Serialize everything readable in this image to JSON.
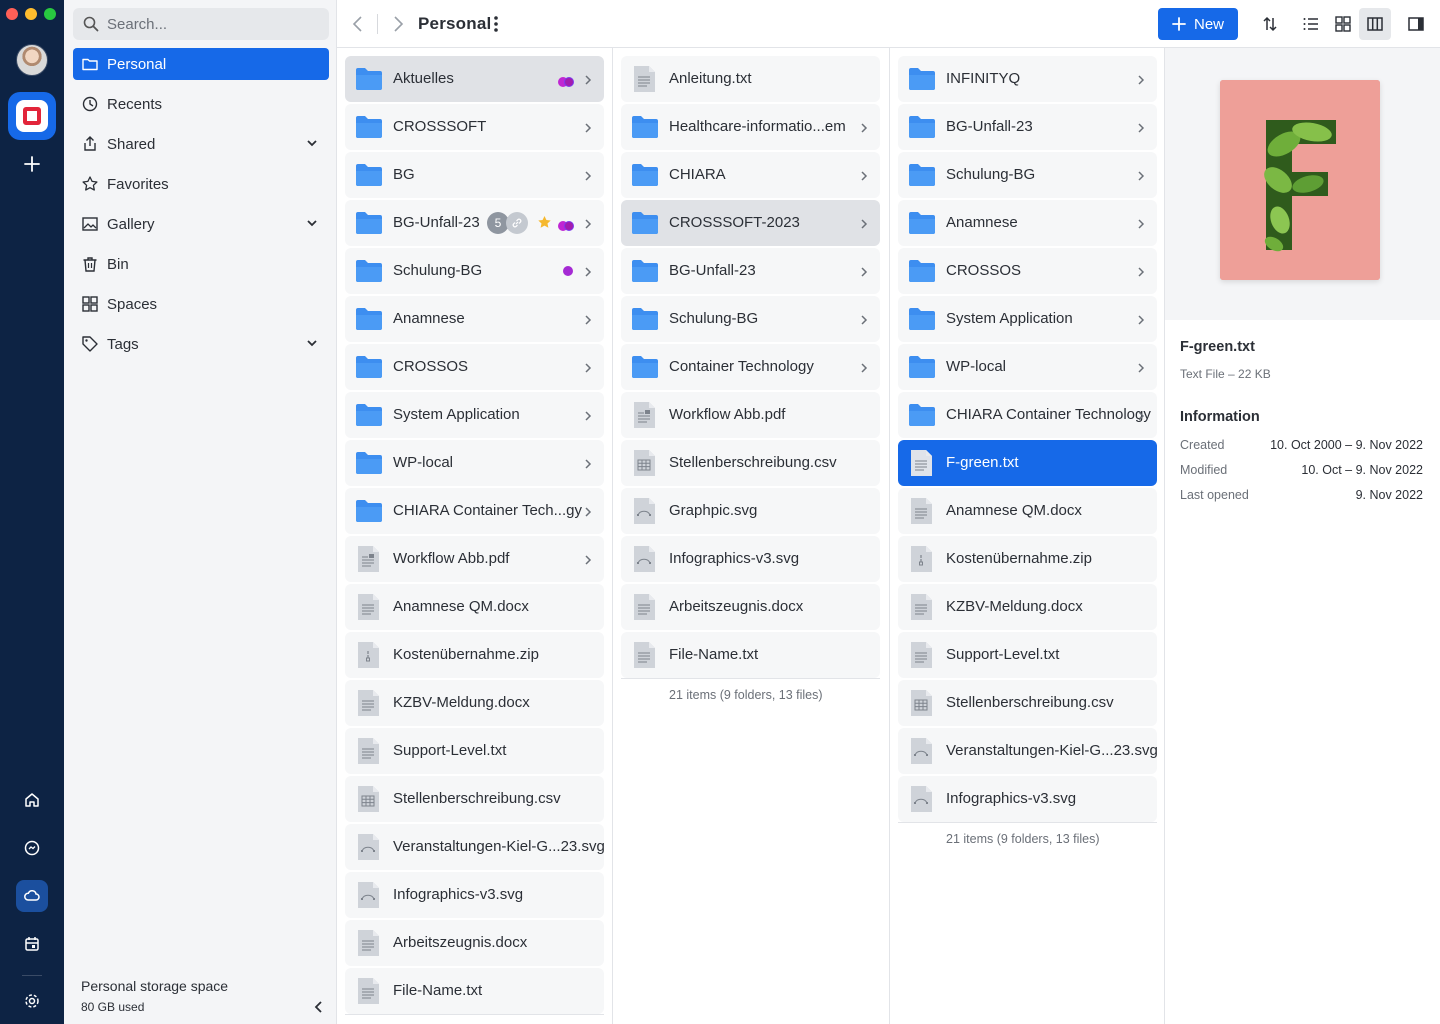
{
  "colors": {
    "accent": "#1669e8",
    "rail": "#0d2344",
    "folder": "#3d8ef0",
    "purple": "#a52ad4",
    "star": "#f5b82e"
  },
  "window_controls": [
    "close",
    "minimize",
    "maximize"
  ],
  "search": {
    "placeholder": "Search..."
  },
  "sidebar": {
    "items": [
      {
        "label": "Personal",
        "icon": "folder-icon",
        "active": true
      },
      {
        "label": "Recents",
        "icon": "clock-icon"
      },
      {
        "label": "Shared",
        "icon": "share-icon",
        "expandable": true
      },
      {
        "label": "Favorites",
        "icon": "star-icon"
      },
      {
        "label": "Gallery",
        "icon": "gallery-icon",
        "expandable": true
      },
      {
        "label": "Bin",
        "icon": "trash-icon"
      },
      {
        "label": "Spaces",
        "icon": "grid-icon"
      },
      {
        "label": "Tags",
        "icon": "tag-icon",
        "expandable": true
      }
    ],
    "storage_title": "Personal storage space",
    "storage_used": "80 GB used"
  },
  "toolbar": {
    "title": "Personal",
    "new_label": "New"
  },
  "columns": [
    {
      "items": [
        {
          "name": "Aktuelles",
          "type": "folder",
          "selected": true,
          "tags": [
            "purple-pair"
          ]
        },
        {
          "name": "CROSSSOFT",
          "type": "folder"
        },
        {
          "name": "BG",
          "type": "folder"
        },
        {
          "name": "BG-Unfall-23",
          "type": "folder",
          "share_count": "5",
          "shared_link": true,
          "favorite": true,
          "tags": [
            "purple-pair"
          ]
        },
        {
          "name": "Schulung-BG",
          "type": "folder",
          "tags": [
            "purple"
          ]
        },
        {
          "name": "Anamnese",
          "type": "folder"
        },
        {
          "name": "CROSSOS",
          "type": "folder"
        },
        {
          "name": "System Application",
          "type": "folder"
        },
        {
          "name": "WP-local",
          "type": "folder"
        },
        {
          "name": "CHIARA Container Tech...gy",
          "type": "folder"
        },
        {
          "name": "Workflow Abb.pdf",
          "type": "pdf",
          "arrow": true
        },
        {
          "name": "Anamnese QM.docx",
          "type": "doc"
        },
        {
          "name": "Kostenübernahme.zip",
          "type": "zip"
        },
        {
          "name": "KZBV-Meldung.docx",
          "type": "doc"
        },
        {
          "name": "Support-Level.txt",
          "type": "doc"
        },
        {
          "name": "Stellenberschreibung.csv",
          "type": "csv"
        },
        {
          "name": "Veranstaltungen-Kiel-G...23.svg",
          "type": "svg"
        },
        {
          "name": "Infographics-v3.svg",
          "type": "svg"
        },
        {
          "name": "Arbeitszeugnis.docx",
          "type": "doc"
        },
        {
          "name": "File-Name.txt",
          "type": "doc"
        }
      ]
    },
    {
      "items": [
        {
          "name": "Anleitung.txt",
          "type": "doc"
        },
        {
          "name": "Healthcare-informatio...em",
          "type": "folder"
        },
        {
          "name": "CHIARA",
          "type": "folder"
        },
        {
          "name": "CROSSSOFT-2023",
          "type": "folder",
          "selected": true
        },
        {
          "name": "BG-Unfall-23",
          "type": "folder"
        },
        {
          "name": "Schulung-BG",
          "type": "folder"
        },
        {
          "name": "Container Technology",
          "type": "folder"
        },
        {
          "name": "Workflow Abb.pdf",
          "type": "pdf"
        },
        {
          "name": "Stellenberschreibung.csv",
          "type": "csv"
        },
        {
          "name": "Graphpic.svg",
          "type": "svg"
        },
        {
          "name": "Infographics-v3.svg",
          "type": "svg"
        },
        {
          "name": "Arbeitszeugnis.docx",
          "type": "doc"
        },
        {
          "name": "File-Name.txt",
          "type": "doc"
        }
      ],
      "footer": "21 items   (9 folders, 13 files)"
    },
    {
      "items": [
        {
          "name": "INFINITYQ",
          "type": "folder"
        },
        {
          "name": "BG-Unfall-23",
          "type": "folder"
        },
        {
          "name": "Schulung-BG",
          "type": "folder"
        },
        {
          "name": "Anamnese",
          "type": "folder"
        },
        {
          "name": "CROSSOS",
          "type": "folder"
        },
        {
          "name": "System Application",
          "type": "folder"
        },
        {
          "name": "WP-local",
          "type": "folder"
        },
        {
          "name": "CHIARA Container Technology",
          "type": "folder"
        },
        {
          "name": "F-green.txt",
          "type": "doc",
          "active": true
        },
        {
          "name": "Anamnese QM.docx",
          "type": "doc"
        },
        {
          "name": "Kostenübernahme.zip",
          "type": "zip"
        },
        {
          "name": "KZBV-Meldung.docx",
          "type": "doc"
        },
        {
          "name": "Support-Level.txt",
          "type": "doc"
        },
        {
          "name": "Stellenberschreibung.csv",
          "type": "csv"
        },
        {
          "name": "Veranstaltungen-Kiel-G...23.svg",
          "type": "svg"
        },
        {
          "name": "Infographics-v3.svg",
          "type": "svg"
        }
      ],
      "footer": "21 items   (9 folders, 13 files)"
    }
  ],
  "detail": {
    "filename": "F-green.txt",
    "meta": "Text File  –  22 KB",
    "info_title": "Information",
    "rows": [
      {
        "label": "Created",
        "value": "10. Oct 2000 – 9. Nov 2022"
      },
      {
        "label": "Modified",
        "value": "10. Oct – 9. Nov 2022"
      },
      {
        "label": "Last opened",
        "value": "9. Nov 2022"
      }
    ]
  }
}
